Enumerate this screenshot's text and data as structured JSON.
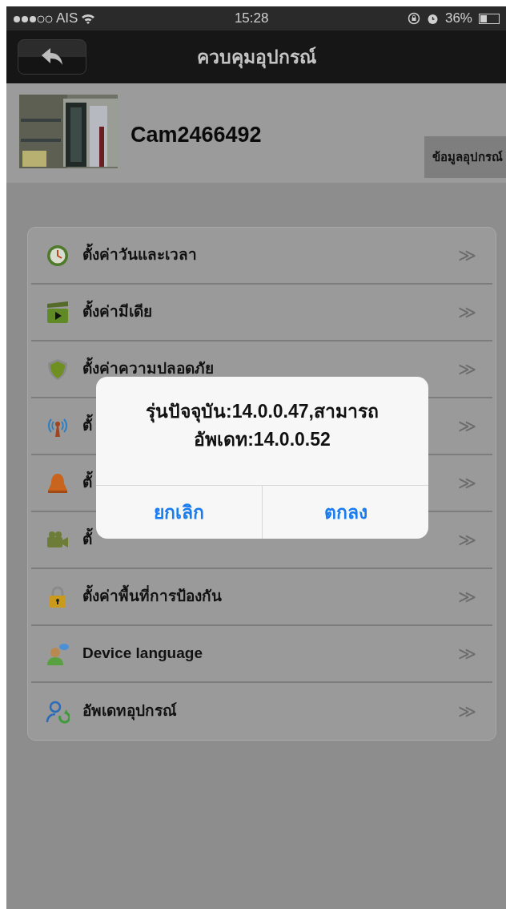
{
  "status_bar": {
    "carrier": "AIS",
    "time": "15:28",
    "battery": "36%"
  },
  "nav_bar": {
    "title": "ควบคุมอุปกรณ์"
  },
  "device": {
    "name": "Cam2466492",
    "info_button": "ข้อมูลอุปกรณ์"
  },
  "menu": [
    {
      "label": "ตั้งค่าวันและเวลา",
      "chevron": "≫"
    },
    {
      "label": "ตั้งค่ามีเดีย",
      "chevron": "≫"
    },
    {
      "label": "ตั้งค่าความปลอดภัย",
      "chevron": "≫"
    },
    {
      "label": "ตั้",
      "chevron": "≫"
    },
    {
      "label": "ตั้",
      "chevron": "≫"
    },
    {
      "label": "ตั้",
      "chevron": "≫"
    },
    {
      "label": "ตั้งค่าพื้นที่การป้องกัน",
      "chevron": "≫"
    },
    {
      "label": "Device language",
      "chevron": "≫"
    },
    {
      "label": "อัพเดทอุปกรณ์",
      "chevron": "≫"
    }
  ],
  "alert": {
    "message_lines": [
      "รุ่นปัจจุบัน:14.0.0.47,สามารถ",
      "อัพเดท:14.0.0.52"
    ],
    "buttons": [
      "ยกเลิก",
      "ตกลง"
    ]
  }
}
